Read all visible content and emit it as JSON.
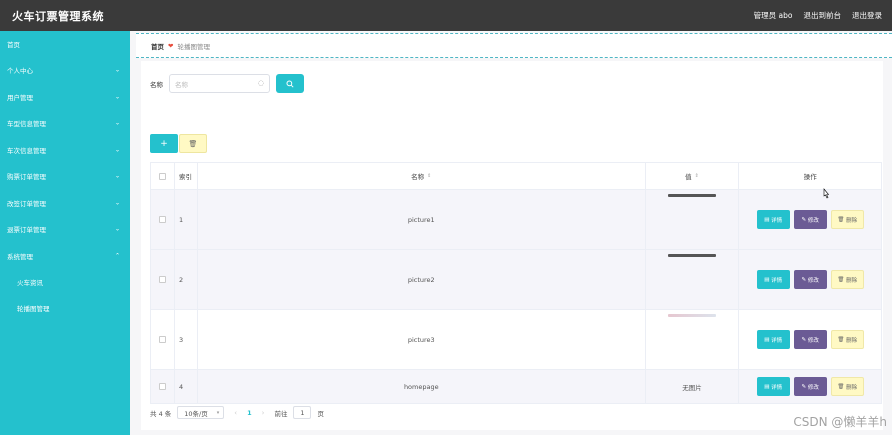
{
  "app": {
    "title": "火车订票管理系统",
    "admin_label": "管理员 abo",
    "back_to_front": "退出到前台",
    "logout": "退出登录"
  },
  "sidebar": {
    "items": [
      {
        "label": "首页",
        "has_arrow": false
      },
      {
        "label": "个人中心",
        "has_arrow": true
      },
      {
        "label": "用户管理",
        "has_arrow": true
      },
      {
        "label": "车型信息管理",
        "has_arrow": true
      },
      {
        "label": "车次信息管理",
        "has_arrow": true
      },
      {
        "label": "购票订单管理",
        "has_arrow": true
      },
      {
        "label": "改签订单管理",
        "has_arrow": true
      },
      {
        "label": "退票订单管理",
        "has_arrow": true
      },
      {
        "label": "系统管理",
        "has_arrow": true,
        "expanded": true
      }
    ],
    "subitems": [
      {
        "label": "火车资讯"
      },
      {
        "label": "轮播图管理"
      }
    ]
  },
  "breadcrumb": {
    "home": "首页",
    "separator": "❤",
    "current": "轮播图管理"
  },
  "search": {
    "label": "名称",
    "placeholder": "名称"
  },
  "toolbar": {
    "add_label": "+",
    "delete_label": "🗑"
  },
  "table": {
    "columns": {
      "index": "索引",
      "name": "名称",
      "image": "值"
    },
    "ops_header": "操作",
    "ops": {
      "detail": "详情",
      "edit": "修改",
      "delete": "删除"
    },
    "rows": [
      {
        "index": "1",
        "name": "picture1",
        "image_text": "",
        "image_color": "#555555"
      },
      {
        "index": "2",
        "name": "picture2",
        "image_text": "",
        "image_color": "#555555"
      },
      {
        "index": "3",
        "name": "picture3",
        "image_text": "",
        "image_color": "#dde3ec"
      },
      {
        "index": "4",
        "name": "homepage",
        "image_text": "无图片",
        "image_color": ""
      }
    ]
  },
  "pagination": {
    "total": "共 4 条",
    "page_size": "10条/页",
    "prev": "‹",
    "current_page": "1",
    "next": "›",
    "goto_label": "前往",
    "goto_value": "1",
    "page_suffix": "页"
  },
  "watermark": "CSDN @懒羊羊h",
  "colors": {
    "accent": "#24c1cd",
    "topbar": "#3a3a3a",
    "edit": "#6b5b95",
    "delete": "#fff9c4"
  }
}
